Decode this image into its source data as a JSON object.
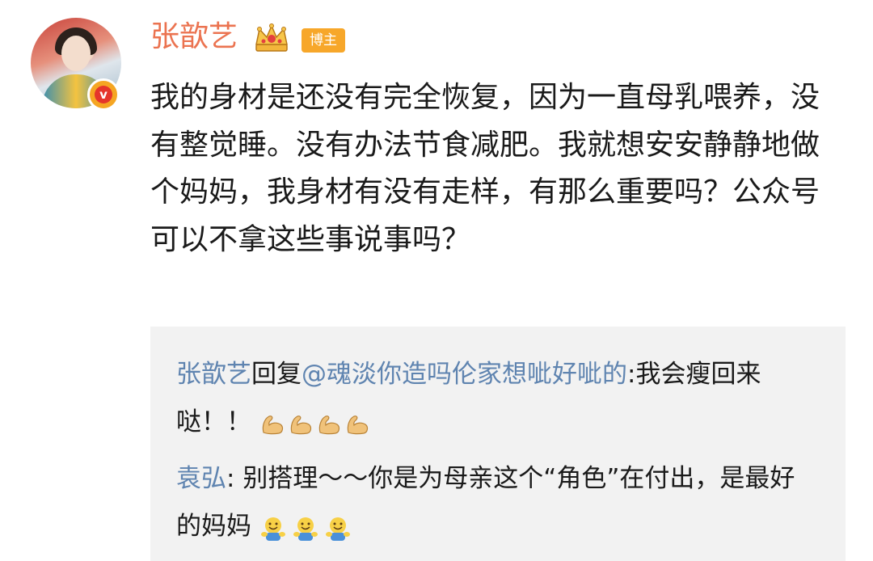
{
  "post": {
    "author": "张歆艺",
    "badge_label": "博主",
    "verified_mark": "v",
    "text": "我的身材是还没有完全恢复，因为一直母乳喂养，没有整觉睡。没有办法节食减肥。我就想安安静静地做个妈妈，我身材有没有走样，有那么重要吗？公众号可以不拿这些事说事吗？"
  },
  "replies": [
    {
      "author": "张歆艺",
      "action": "回复",
      "mention": "@魂淡你造吗伦家想呲好呲的",
      "separator": ":",
      "text": "我会瘦回来哒！！",
      "emojis": [
        "muscle-icon",
        "muscle-icon",
        "muscle-icon",
        "muscle-icon"
      ]
    },
    {
      "author": "袁弘",
      "separator": ": ",
      "text": "别搭理～～你是为母亲这个“角色”在付出，是最好的妈妈",
      "emojis": [
        "hug-face-icon",
        "hug-face-icon",
        "hug-face-icon"
      ]
    }
  ],
  "colors": {
    "author_name": "#eb7350",
    "link": "#5f84b0",
    "badge_bg": "#f7a72a",
    "reply_bg": "#f2f2f2",
    "verified_bg": "#e5352b"
  }
}
